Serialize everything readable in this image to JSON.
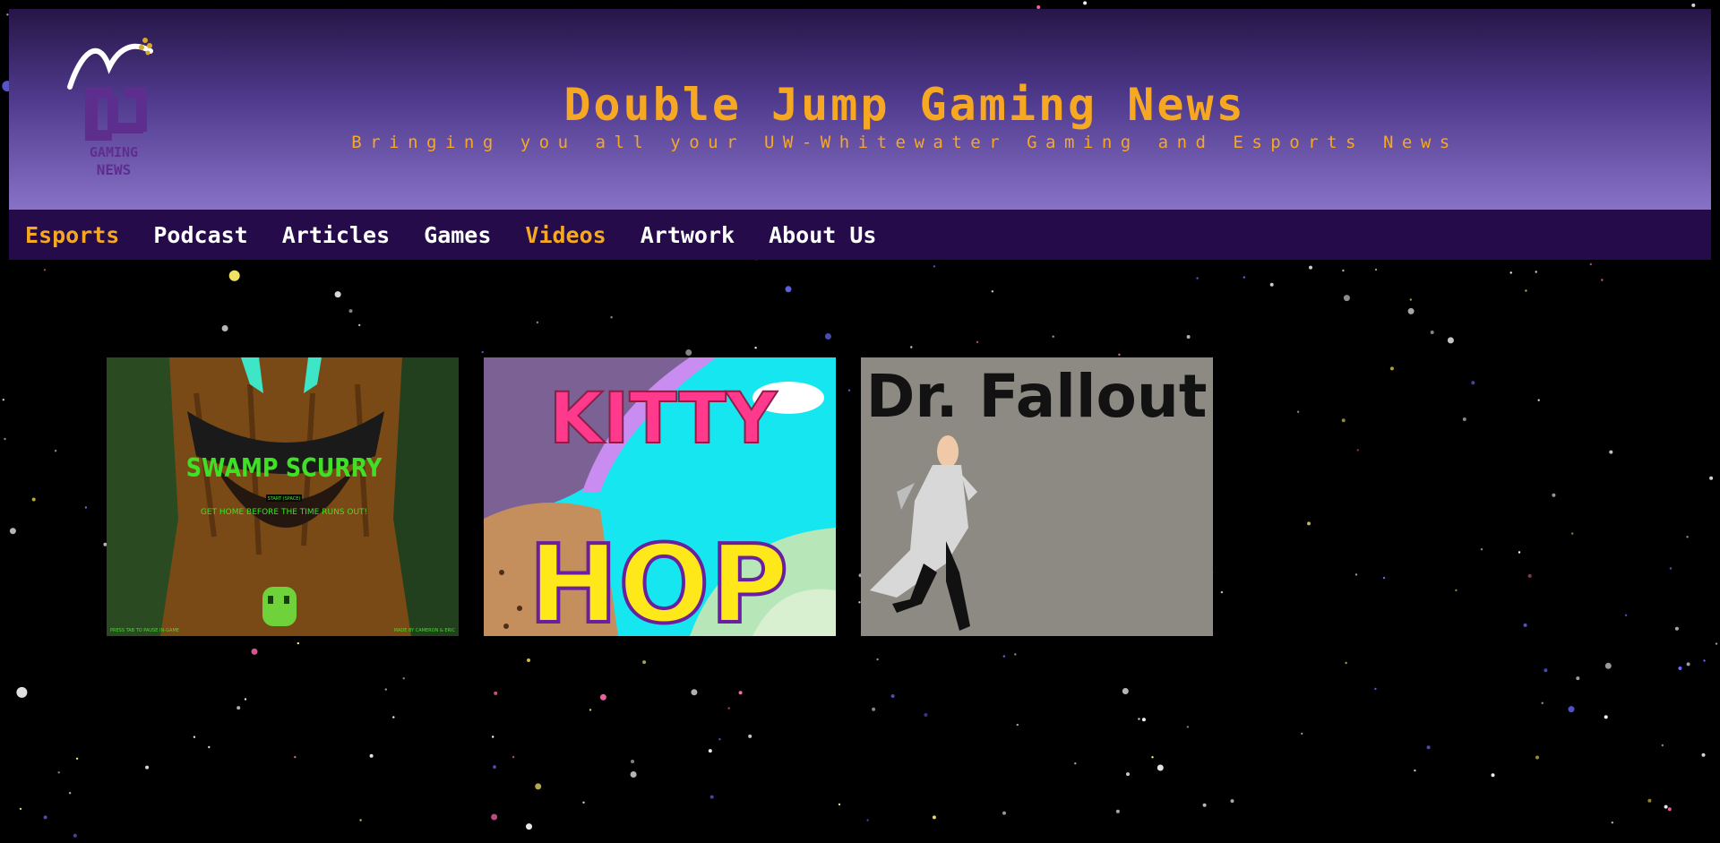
{
  "header": {
    "title": "Double Jump Gaming News",
    "subtitle": "Bringing you all your UW-Whitewater Gaming and Esports News",
    "logo_text_top": "GAMING",
    "logo_text_bottom": "NEWS"
  },
  "nav": {
    "items": [
      {
        "label": "Esports",
        "highlight": true
      },
      {
        "label": "Podcast",
        "highlight": false
      },
      {
        "label": "Articles",
        "highlight": false
      },
      {
        "label": "Games",
        "highlight": false
      },
      {
        "label": "Videos",
        "highlight": true
      },
      {
        "label": "Artwork",
        "highlight": false
      },
      {
        "label": "About Us",
        "highlight": false
      }
    ]
  },
  "games": [
    {
      "title": "SWAMP SCURRY",
      "start": "START (SPACE)",
      "tagline": "GET HOME BEFORE THE TIME RUNS OUT!",
      "footer_left": "PRESS TAB TO PAUSE IN-GAME",
      "footer_right": "MADE BY CAMERON & ERIC"
    },
    {
      "title_top": "KITTY",
      "title_bottom": "HOP"
    },
    {
      "title": "Dr. Fallout"
    }
  ],
  "colors": {
    "accent": "#f6a822",
    "nav_bg": "#250b4a",
    "header_top": "#261547",
    "header_bottom": "#8872c7"
  }
}
